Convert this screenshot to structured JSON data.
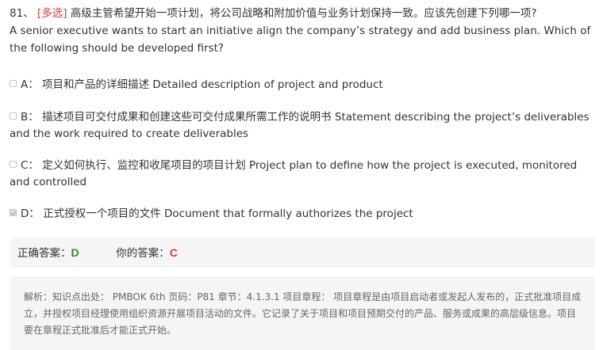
{
  "question": {
    "number": "81、",
    "type_tag": "[多选]",
    "text_cn": "高级主管希望开始一项计划，将公司战略和附加价值与业务计划保持一致。应该先创建下列哪一项?",
    "text_en": "A senior executive wants to start an initiative align the company’s strategy and add business plan. Which of the following should be developed first?"
  },
  "options": [
    {
      "letter": "A：",
      "text": "项目和产品的详细描述 Detailed description of project and product",
      "checked": false
    },
    {
      "letter": "B：",
      "text": "描述项目可交付成果和创建这些可交付成果所需工作的说明书 Statement describing the project’s deliverables and the work required to create deliverables",
      "checked": false
    },
    {
      "letter": "C：",
      "text": "定义如何执行、监控和收尾项目的项目计划 Project plan to define how the project is executed, monitored and controlled",
      "checked": false
    },
    {
      "letter": "D：",
      "text": "正式授权一个项目的文件 Document that formally authorizes the project",
      "checked": true
    }
  ],
  "answers": {
    "correct_label": "正确答案：",
    "correct_value": "D",
    "yours_label": "你的答案：",
    "yours_value": "C"
  },
  "analysis": {
    "text": "解析：知识点出处： PMBOK 6th 页码：P81 章节：4.1.3.1 项目章程： 项目章程是由项目启动者或发起人发布的，正式批准项目成立，并授权项目经理使用组织资源开展项目活动的文件。它记录了关于项目和项目预期交付的产品、服务或成果的高层级信息。项目要在章程正式批准后才能正式开始。"
  },
  "colors": {
    "qtype": "#e03a3a",
    "correct": "#2e8b2e",
    "yours": "#e03a3a",
    "panel_bg": "#f5f5f5"
  }
}
